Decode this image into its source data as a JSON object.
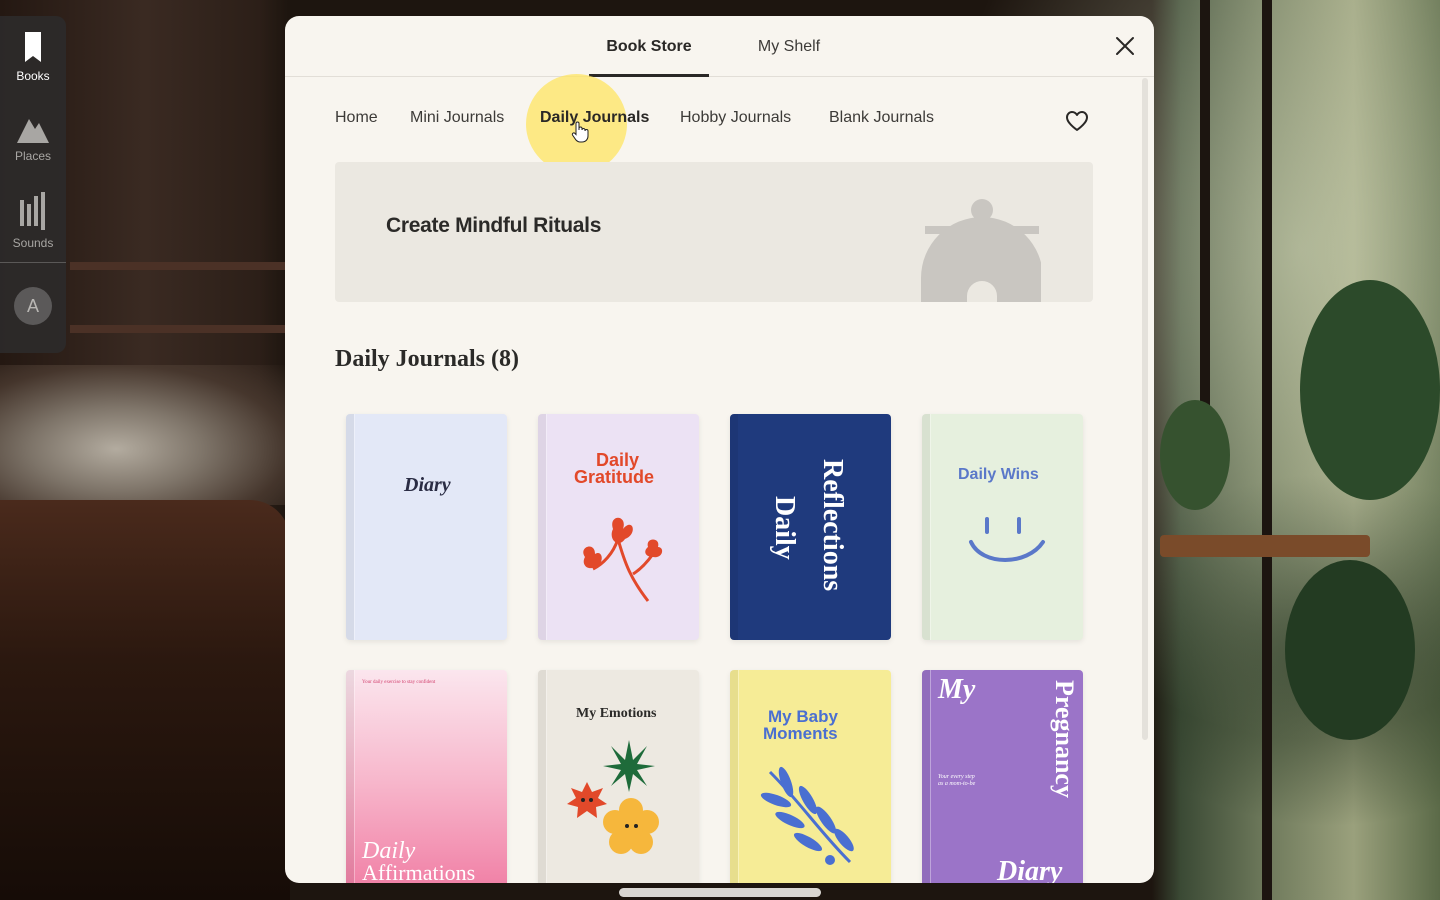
{
  "sidebar": {
    "items": [
      {
        "label": "Books",
        "icon": "bookmark-icon",
        "active": true
      },
      {
        "label": "Places",
        "icon": "mountain-icon",
        "active": false
      },
      {
        "label": "Sounds",
        "icon": "sound-bars-icon",
        "active": false
      }
    ],
    "avatar_initial": "A"
  },
  "tabs": [
    {
      "label": "Book Store",
      "active": true
    },
    {
      "label": "My Shelf",
      "active": false
    }
  ],
  "categories": [
    {
      "label": "Home",
      "active": false
    },
    {
      "label": "Mini Journals",
      "active": false
    },
    {
      "label": "Daily Journals",
      "active": true
    },
    {
      "label": "Hobby Journals",
      "active": false
    },
    {
      "label": "Blank Journals",
      "active": false
    }
  ],
  "banner": {
    "title": "Create Mindful Rituals"
  },
  "section": {
    "title": "Daily Journals (8)"
  },
  "books": [
    {
      "title": "Diary",
      "color": "#e3e8f7"
    },
    {
      "title_line1": "Daily",
      "title_line2": "Gratitude",
      "color": "#ece2f4"
    },
    {
      "title_line1": "Reflections",
      "title_line2": "Daily",
      "color": "#1f3a7d"
    },
    {
      "title": "Daily Wins",
      "color": "#e6f0de"
    },
    {
      "tagline": "Your daily exercise to stay confident",
      "title_line1": "Daily",
      "title_line2": "Affirmations",
      "color": "#f28cb0"
    },
    {
      "title": "My Emotions",
      "color": "#ede9e1"
    },
    {
      "title_line1": "My Baby",
      "title_line2": "Moments",
      "color": "#f6ec96"
    },
    {
      "title_my": "My",
      "title_vertical": "Pregnancy",
      "tagline_line1": "Your every step",
      "tagline_line2": "as a mom-to-be",
      "title_bottom": "Diary",
      "color": "#9b74c8"
    }
  ],
  "colors": {
    "panel_bg": "#f8f5ef",
    "highlight": "#ffe45c",
    "sidebar_bg": "#2d2a2a"
  }
}
